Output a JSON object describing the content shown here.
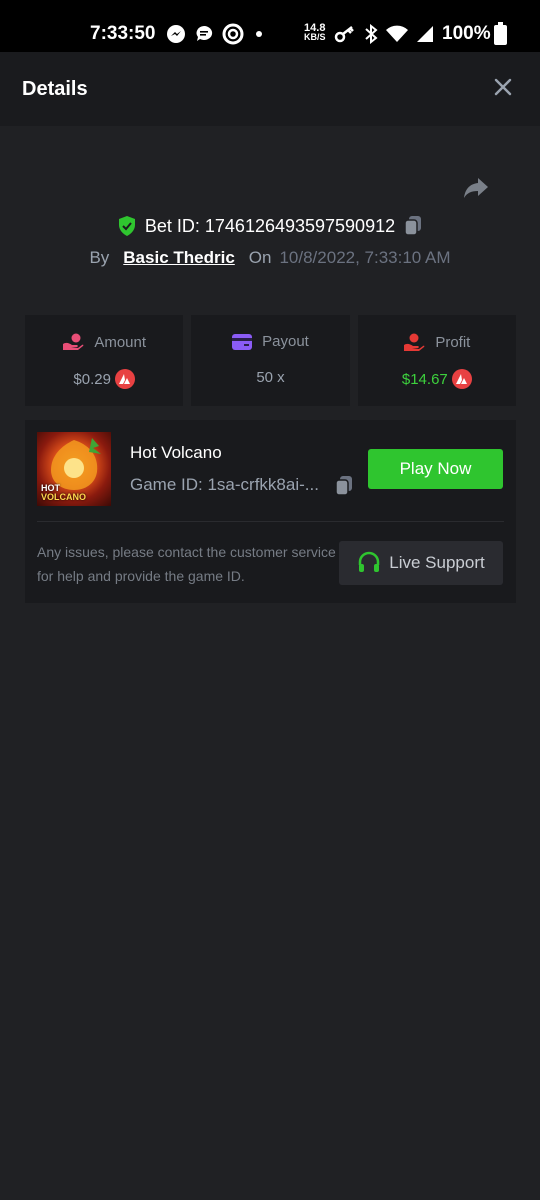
{
  "status_bar": {
    "time": "7:33:50",
    "net_speed_value": "14.8",
    "net_speed_unit": "KB/S",
    "battery": "100%"
  },
  "header": {
    "title": "Details"
  },
  "bet": {
    "bet_id": "Bet ID: 1746126493597590912",
    "by_label": "By",
    "user": "Basic Thedric",
    "on_label": "On",
    "date": "10/8/2022, 7:33:10 AM"
  },
  "stats": [
    {
      "label": "Amount",
      "value": "$0.29",
      "icon": "money-hand-icon",
      "color": "#e94e77"
    },
    {
      "label": "Payout",
      "value": "50 x",
      "icon": "card-icon",
      "color": "#8b5cf6"
    },
    {
      "label": "Profit",
      "value": "$14.67",
      "icon": "profit-hand-icon",
      "color": "#e53935"
    }
  ],
  "game": {
    "name": "Hot Volcano",
    "game_id": "Game ID: 1sa-crfkk8ai-...",
    "thumb_line1": "HOT",
    "thumb_line2": "VOLCANO",
    "play_label": "Play Now",
    "help_text": "Any issues, please contact the customer service for help and provide the game ID.",
    "support_label": "Live Support"
  },
  "colors": {
    "accent_green": "#2fc52f",
    "profit_green": "#3dd13d",
    "coin_red": "#e84142",
    "bg": "#202124",
    "card": "#191a1d"
  }
}
